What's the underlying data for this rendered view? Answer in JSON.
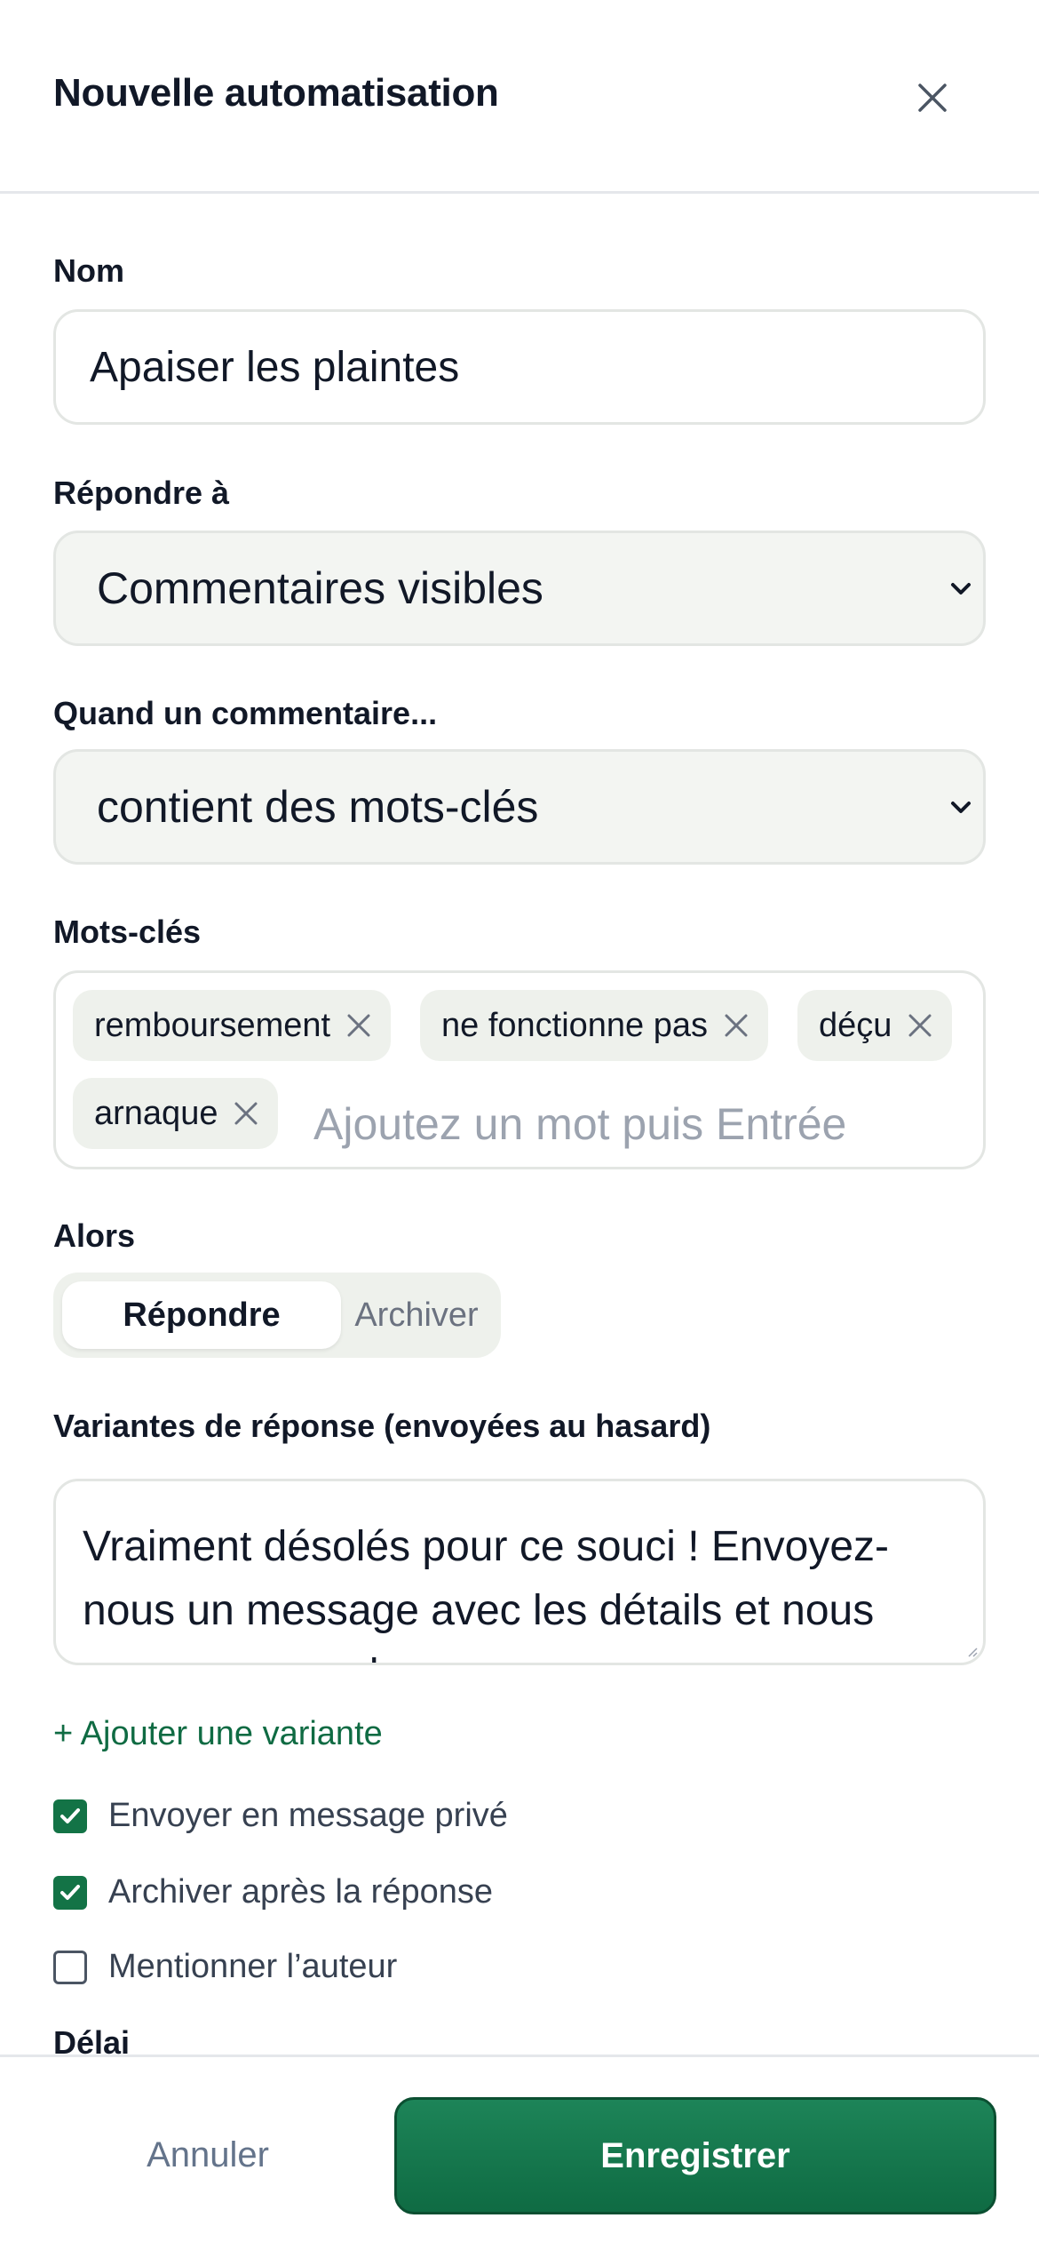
{
  "header": {
    "title": "Nouvelle automatisation",
    "close_icon": "close-icon"
  },
  "name_field": {
    "label": "Nom",
    "value": "Apaiser les plaintes"
  },
  "reply_to": {
    "label": "Répondre à",
    "selected": "Commentaires visibles"
  },
  "condition": {
    "label": "Quand un commentaire...",
    "selected": "contient des mots-clés"
  },
  "keywords": {
    "label": "Mots-clés",
    "tags": [
      "remboursement",
      "ne fonctionne pas",
      "déçu",
      "arnaque"
    ],
    "placeholder": "Ajoutez un mot puis Entrée"
  },
  "action": {
    "label": "Alors",
    "options": [
      "Répondre",
      "Archiver"
    ],
    "selected": "Répondre"
  },
  "variants": {
    "label": "Variantes de réponse (envoyées au hasard)",
    "text": "Vraiment désolés pour ce souci ! Envoyez-nous un message avec les détails et nous arrangerons cela.",
    "add_label": "+ Ajouter une variante"
  },
  "options": [
    {
      "label": "Envoyer en message privé",
      "checked": true
    },
    {
      "label": "Archiver après la réponse",
      "checked": true
    },
    {
      "label": "Mentionner l’auteur",
      "checked": false
    }
  ],
  "delay": {
    "label": "Délai"
  },
  "footer": {
    "cancel_label": "Annuler",
    "save_label": "Enregistrer"
  },
  "colors": {
    "accent": "#137346",
    "button": "#1a7a4f",
    "tag_bg": "#eef1ec",
    "select_bg": "#f3f5f2"
  }
}
